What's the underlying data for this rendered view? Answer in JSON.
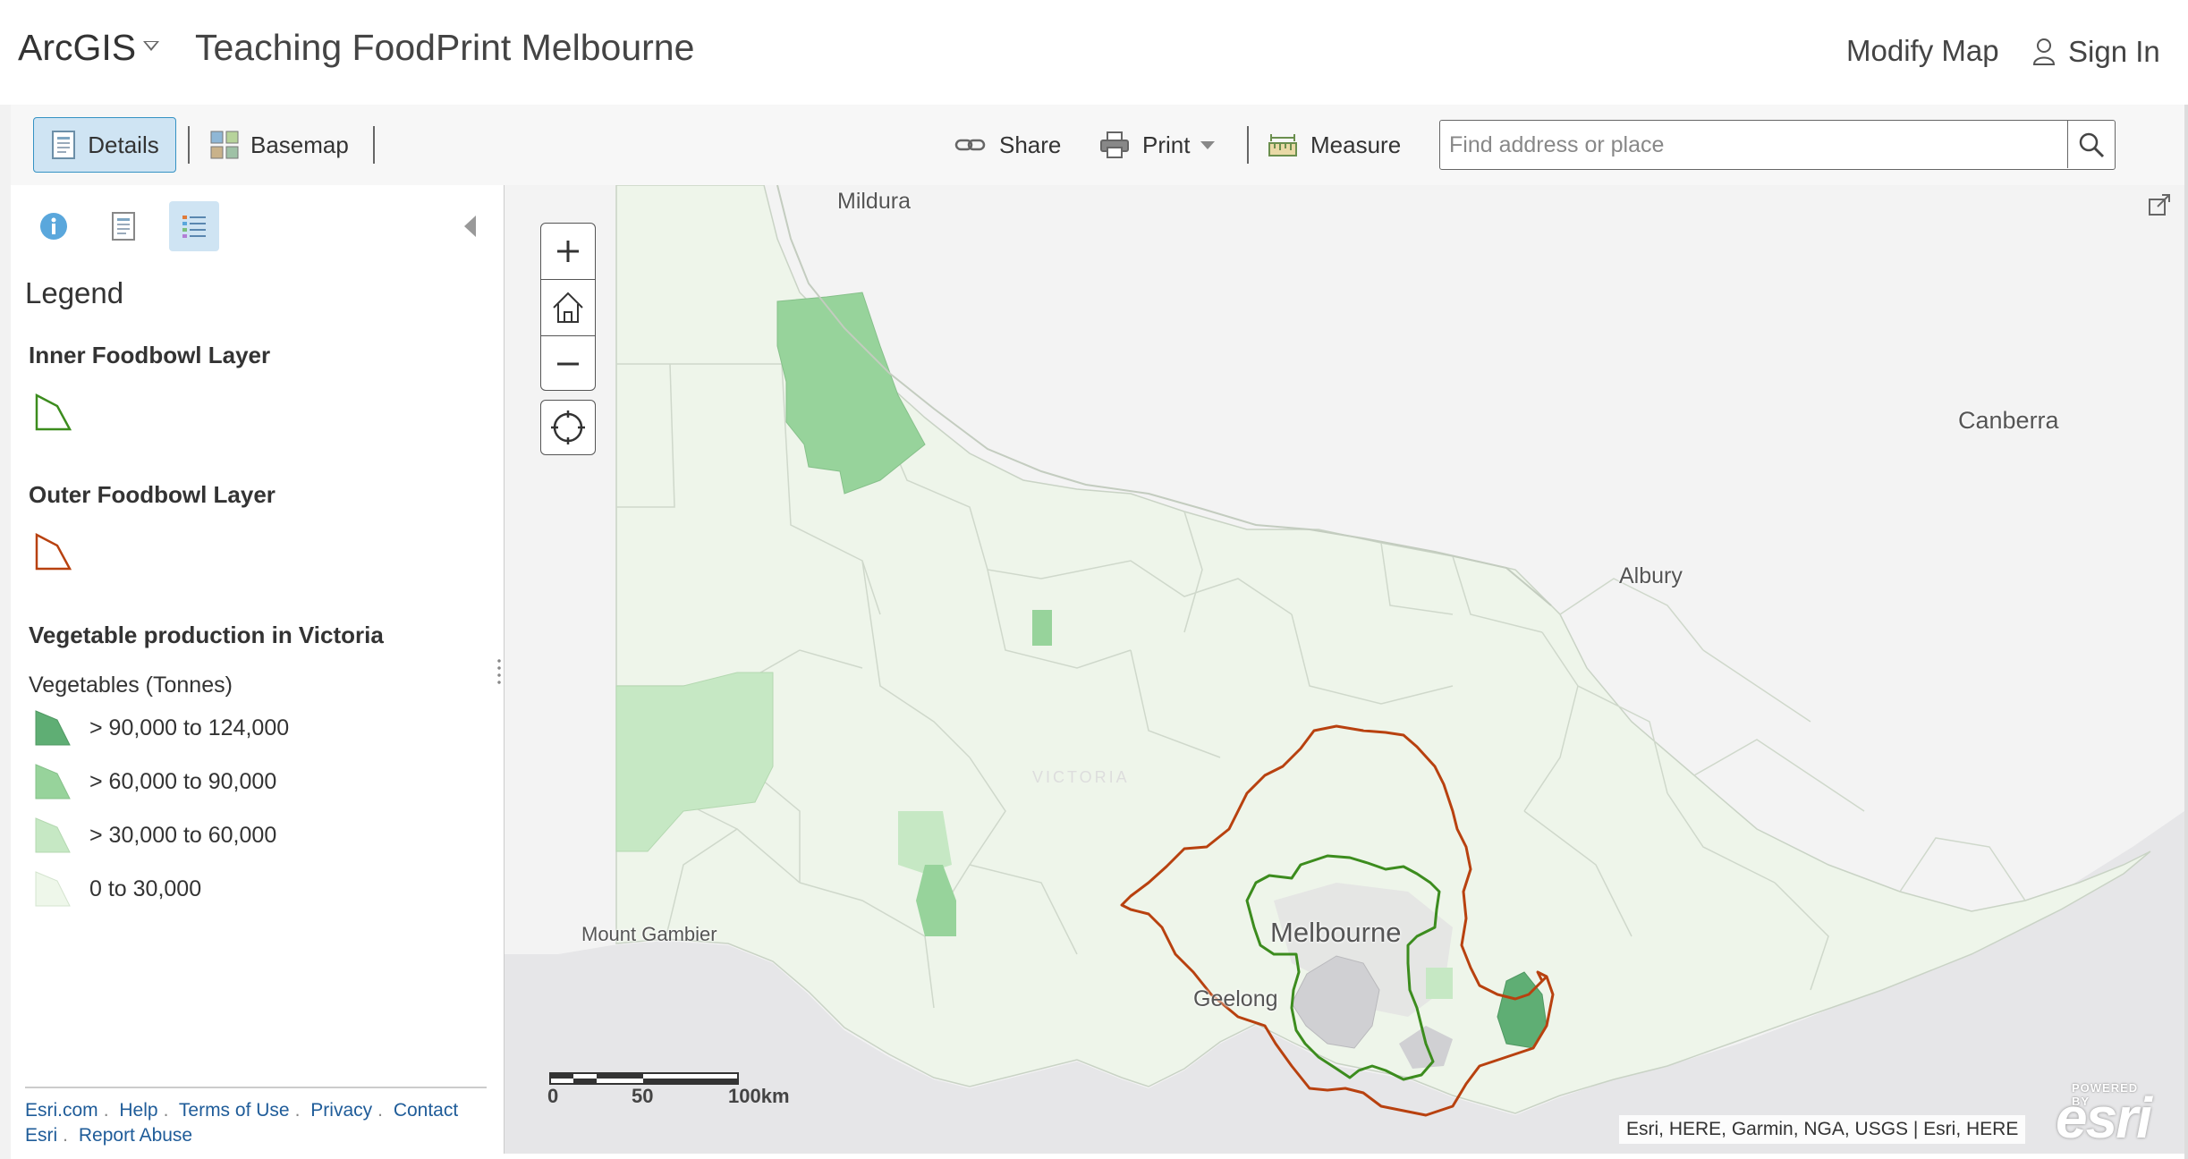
{
  "header": {
    "app_name": "ArcGIS",
    "map_title": "Teaching FoodPrint Melbourne",
    "modify_map": "Modify Map",
    "sign_in": "Sign In"
  },
  "toolbar": {
    "details": "Details",
    "basemap": "Basemap",
    "share": "Share",
    "print": "Print",
    "measure": "Measure",
    "search_placeholder": "Find address or place"
  },
  "legend": {
    "title": "Legend",
    "layers": [
      {
        "title": "Inner Foodbowl Layer",
        "color": "#3c8c1e"
      },
      {
        "title": "Outer Foodbowl Layer",
        "color": "#b8410f"
      }
    ],
    "vegetable_layer": {
      "title": "Vegetable production in Victoria",
      "field": "Vegetables (Tonnes)",
      "classes": [
        {
          "label": "> 90,000 to 124,000",
          "color": "#5fae74"
        },
        {
          "label": "> 60,000 to 90,000",
          "color": "#97d39b"
        },
        {
          "label": "> 30,000 to 60,000",
          "color": "#c6e8c4"
        },
        {
          "label": "0 to 30,000",
          "color": "#eef7ea"
        }
      ]
    }
  },
  "footer": {
    "links": [
      "Esri.com",
      "Help",
      "Terms of Use",
      "Privacy",
      "Contact Esri",
      "Report Abuse"
    ]
  },
  "map": {
    "places": [
      "Mildura",
      "Canberra",
      "Albury",
      "Melbourne",
      "Geelong",
      "Mount Gambier"
    ],
    "faint_label": "VICTORIA",
    "scale_labels": [
      "0",
      "50",
      "100km"
    ],
    "attribution": "Esri, HERE, Garmin, NGA, USGS | Esri, HERE",
    "logo_powered": "POWERED BY",
    "logo_word": "esri"
  },
  "colors": {
    "accent": "#3592c4",
    "inner_foodbowl": "#3c8c1e",
    "outer_foodbowl": "#b8410f"
  }
}
